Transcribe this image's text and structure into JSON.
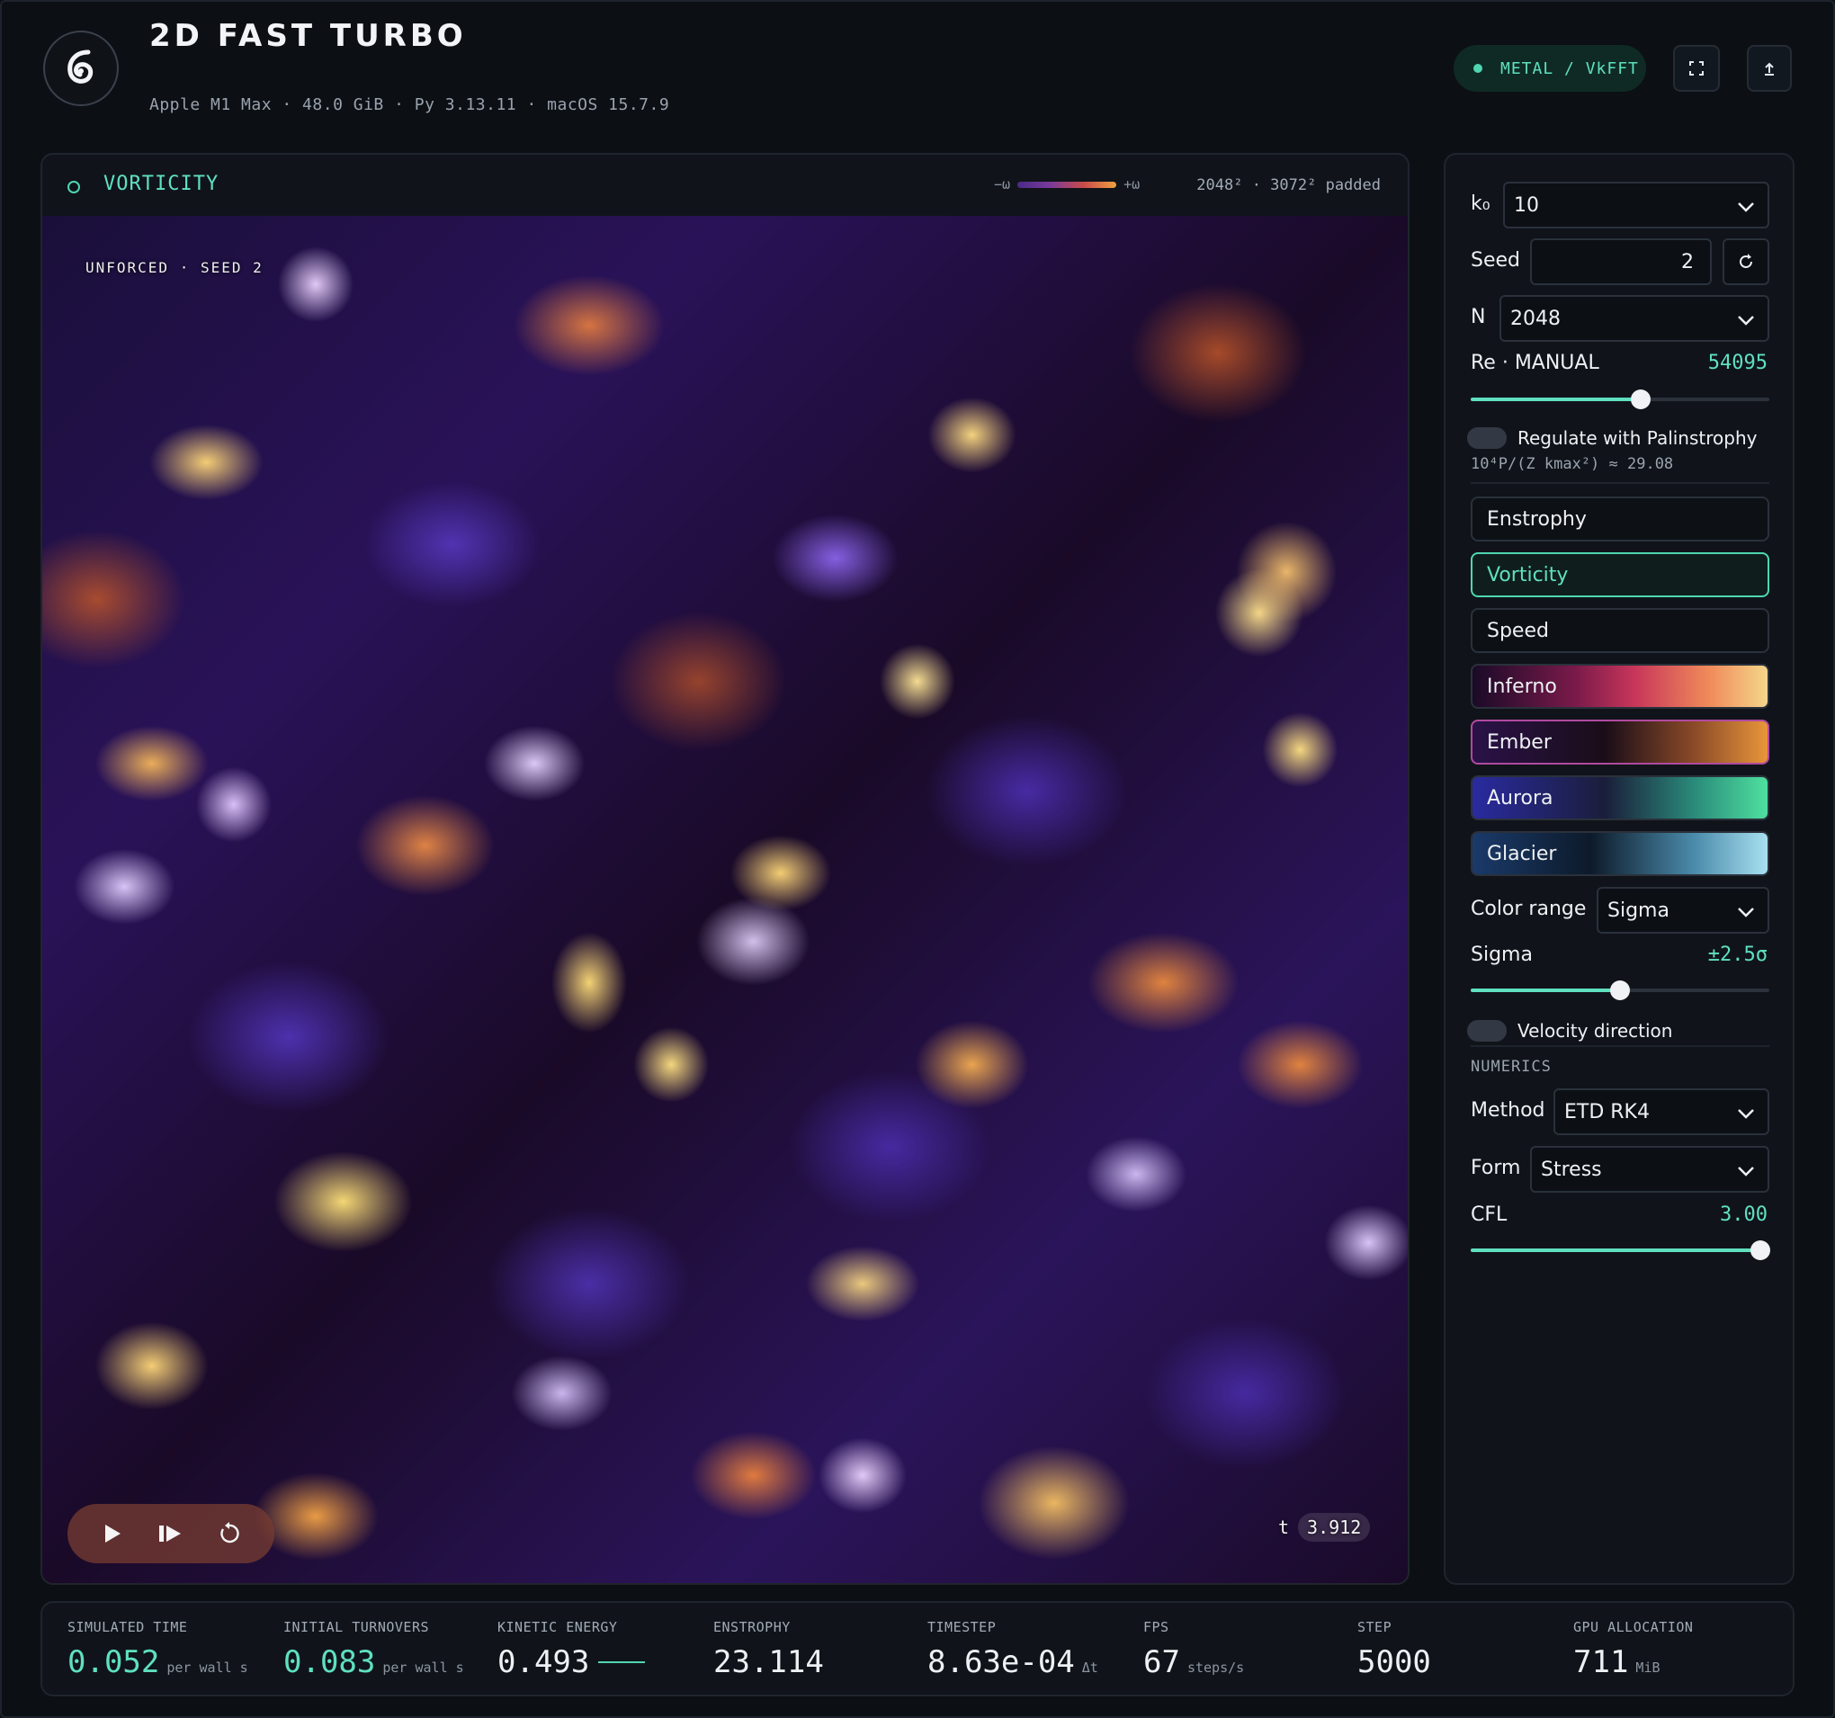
{
  "header": {
    "title": "2D FAST TURBO",
    "sysinfo": "Apple M1 Max · 48.0 GiB · Py 3.13.11 · macOS 15.7.9",
    "backend": "METAL / VkFFT",
    "fullscreen_icon": "fullscreen-icon",
    "export_icon": "export-icon"
  },
  "viz": {
    "label": "VORTICITY",
    "legend_neg": "−ω",
    "legend_pos": "+ω",
    "resolution": "2048² · 3072² padded",
    "tag": "UNFORCED · SEED 2",
    "time_label": "t",
    "time_value": "3.912",
    "transport": {
      "play_icon": "play-icon",
      "step_icon": "step-forward-icon",
      "reset_icon": "reset-icon"
    }
  },
  "sidebar": {
    "k0_label": "k₀",
    "k0_value": "10",
    "seed_label": "Seed",
    "seed_value": "2",
    "n_label": "N",
    "n_value": "2048",
    "re_label": "Re · MANUAL",
    "re_value": "54095",
    "re_slider": 0.57,
    "regulate_label": "Regulate with Palinstrophy",
    "regulate_formula": "10⁴P/(Z kmax²) ≈ 29.08",
    "fields": [
      "Enstrophy",
      "Vorticity",
      "Speed"
    ],
    "active_field": "Vorticity",
    "colormaps": [
      "Inferno",
      "Ember",
      "Aurora",
      "Glacier"
    ],
    "active_colormap": "Ember",
    "color_range_label": "Color range",
    "color_range_value": "Sigma",
    "sigma_label": "Sigma",
    "sigma_value": "±2.5σ",
    "sigma_slider": 0.5,
    "velocity_label": "Velocity direction",
    "numerics_head": "NUMERICS",
    "method_label": "Method",
    "method_value": "ETD RK4",
    "form_label": "Form",
    "form_value": "Stress",
    "cfl_label": "CFL",
    "cfl_value": "3.00",
    "cfl_slider": 0.97
  },
  "stats": [
    {
      "label": "SIMULATED TIME",
      "value": "0.052",
      "unit": "per wall s",
      "teal": true
    },
    {
      "label": "INITIAL TURNOVERS",
      "value": "0.083",
      "unit": "per wall s",
      "teal": true
    },
    {
      "label": "KINETIC ENERGY",
      "value": "0.493",
      "unit": "",
      "teal": false
    },
    {
      "label": "ENSTROPHY",
      "value": "23.114",
      "unit": "",
      "teal": false
    },
    {
      "label": "TIMESTEP",
      "value": "8.63e-04",
      "unit": "Δt",
      "teal": false
    },
    {
      "label": "FPS",
      "value": "67",
      "unit": "steps/s",
      "teal": false
    },
    {
      "label": "STEP",
      "value": "5000",
      "unit": "",
      "teal": false
    },
    {
      "label": "GPU ALLOCATION",
      "value": "711",
      "unit": "MiB",
      "teal": false
    }
  ],
  "colors": {
    "accent": "#5fe0bf",
    "background": "#0c0f14",
    "panel": "#10141a"
  }
}
